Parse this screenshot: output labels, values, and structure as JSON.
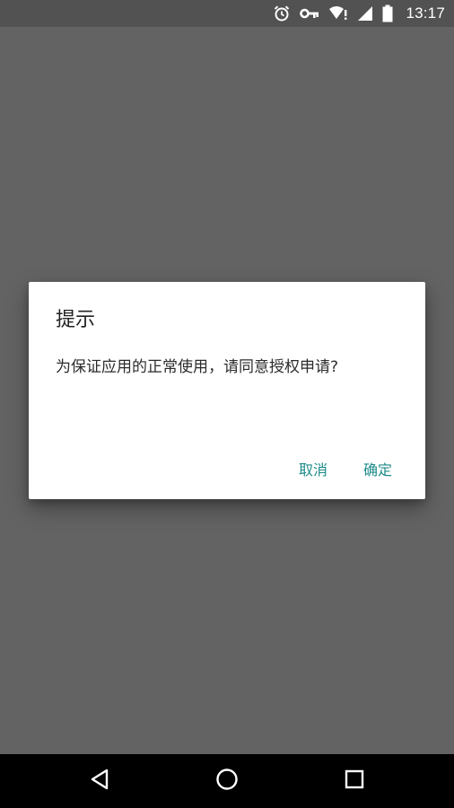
{
  "status_bar": {
    "time": "13:17",
    "icons": [
      "alarm-icon",
      "vpn-key-icon",
      "wifi-alert-icon",
      "signal-icon",
      "battery-icon"
    ]
  },
  "dialog": {
    "title": "提示",
    "message": "为保证应用的正常使用，请同意授权申请?",
    "cancel_label": "取消",
    "confirm_label": "确定",
    "accent_color": "#1e8a8a"
  },
  "nav_bar": {
    "icons": [
      "back-icon",
      "home-icon",
      "recents-icon"
    ]
  },
  "colors": {
    "scrim": "#636363",
    "status_bar": "#525252",
    "nav_bar": "#000000",
    "dialog_bg": "#ffffff"
  }
}
